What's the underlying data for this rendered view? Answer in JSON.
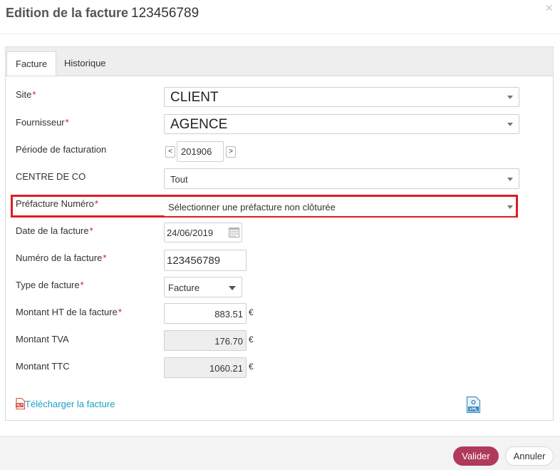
{
  "header": {
    "title": "Edition de la facture",
    "invoice_number": "123456789",
    "close_symbol": "×"
  },
  "tabs": [
    {
      "label": "Facture",
      "active": true
    },
    {
      "label": "Historique",
      "active": false
    }
  ],
  "required_marker": "*",
  "form": {
    "site": {
      "label": "Site",
      "value": "CLIENT"
    },
    "fournisseur": {
      "label": "Fournisseur",
      "value": "AGENCE"
    },
    "periode": {
      "label": "Période de facturation",
      "value": "201906",
      "prev": "<",
      "next": ">"
    },
    "centre": {
      "label": "CENTRE DE CO",
      "value": "Tout"
    },
    "prefacture": {
      "label": "Préfacture Numéro",
      "value": "Sélectionner une préfacture non clôturée"
    },
    "date": {
      "label": "Date de la facture",
      "value": "24/06/2019"
    },
    "numero": {
      "label": "Numéro de la facture",
      "value": "123456789"
    },
    "type": {
      "label": "Type de facture",
      "value": "Facture"
    },
    "montant_ht": {
      "label": "Montant HT de la facture",
      "value": "883.51"
    },
    "montant_tva": {
      "label": "Montant TVA",
      "value": "176.70"
    },
    "montant_ttc": {
      "label": "Montant TTC",
      "value": "1060.21"
    },
    "currency": "€"
  },
  "links": {
    "download": "Télécharger la facture"
  },
  "icons": {
    "pdf": "pdf-file-icon",
    "xml": "xml-file-icon",
    "calendar": "calendar-icon"
  },
  "colors": {
    "accent": "#b03a5b",
    "highlight": "#e01b24",
    "link": "#1aa1c4",
    "required": "#d9141e"
  },
  "footer": {
    "validate_label": "Valider",
    "cancel_label": "Annuler"
  }
}
